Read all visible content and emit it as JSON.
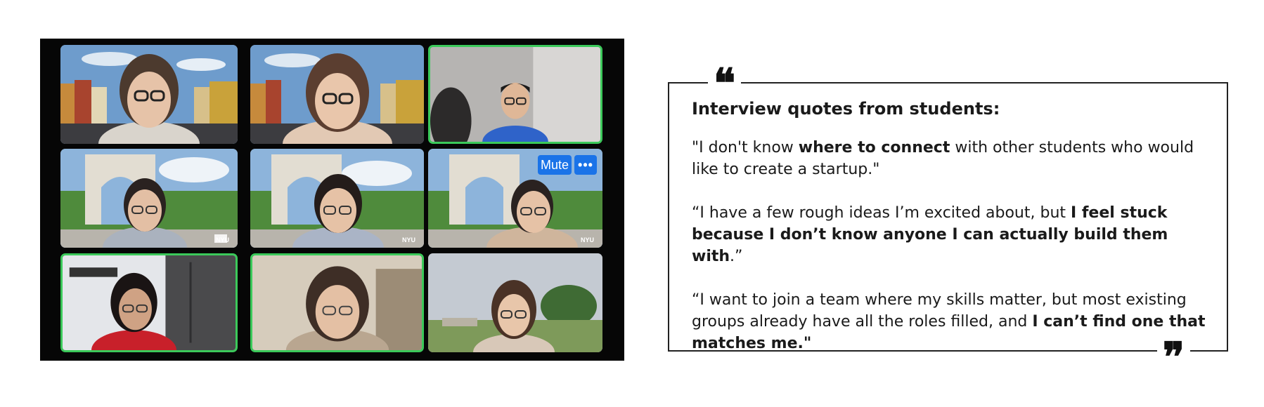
{
  "video_call": {
    "tile_buttons": {
      "mute_label": "Mute",
      "more_label": "•••"
    },
    "badge_label": "NYU",
    "participants": [
      {
        "name": "participant-1",
        "background": "nyhavn",
        "active": false
      },
      {
        "name": "participant-2",
        "background": "nyhavn",
        "active": false
      },
      {
        "name": "participant-3",
        "background": "room-dark",
        "active": true
      },
      {
        "name": "participant-4",
        "background": "washington-square-arch",
        "active": false
      },
      {
        "name": "participant-5",
        "background": "washington-square-arch",
        "active": false
      },
      {
        "name": "participant-6",
        "background": "washington-square-arch",
        "active": false
      },
      {
        "name": "participant-7",
        "background": "kitchen",
        "active": true
      },
      {
        "name": "participant-8",
        "background": "room-blurred",
        "active": true
      },
      {
        "name": "participant-9",
        "background": "park",
        "active": false
      }
    ],
    "colors": {
      "active_border": "#3bc95a",
      "button_bg": "#1a73e8",
      "panel_bg": "#060606"
    }
  },
  "quotes": {
    "heading": "Interview quotes from students:",
    "items": [
      {
        "parts": [
          {
            "text": "\"I don't know ",
            "bold": false
          },
          {
            "text": "where to connect",
            "bold": true
          },
          {
            "text": " with other students who would like to create a startup.\"",
            "bold": false
          }
        ]
      },
      {
        "parts": [
          {
            "text": "“I have a few rough ideas I’m excited about, but ",
            "bold": false
          },
          {
            "text": "I feel stuck because I don’t know anyone I can actually build them with",
            "bold": true
          },
          {
            "text": ".”",
            "bold": false
          }
        ]
      },
      {
        "parts": [
          {
            "text": "“I want to join a team where my skills matter, but most existing groups already have all the roles filled, and ",
            "bold": false
          },
          {
            "text": "I can’t find one that matches me.\"",
            "bold": true
          }
        ]
      }
    ],
    "open_mark": "❝",
    "close_mark": "❞"
  }
}
